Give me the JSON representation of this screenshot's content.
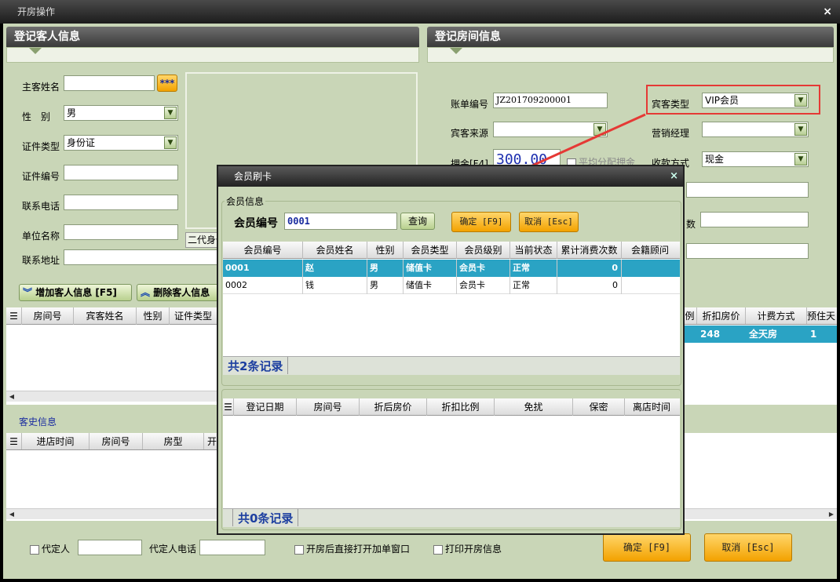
{
  "window": {
    "title": "开房操作",
    "close": "×"
  },
  "guest": {
    "section_title": "登记客人信息",
    "name_label": "主客姓名",
    "name_value": "",
    "name_btn": "***",
    "gender_label": "性　别",
    "gender_value": "男",
    "idtype_label": "证件类型",
    "idtype_value": "身份证",
    "idno_label": "证件编号",
    "idno_value": "",
    "phone_label": "联系电话",
    "phone_value": "",
    "company_label": "单位名称",
    "company_value": "",
    "address_label": "联系地址",
    "address_value": "",
    "idcard_caption": "二代身份证"
  },
  "room": {
    "section_title": "登记房间信息",
    "bill_label": "账单编号",
    "bill_value": "JZ201709200001",
    "guesttype_label": "宾客类型",
    "guesttype_value": "VIP会员",
    "source_label": "宾客来源",
    "source_value": "",
    "manager_label": "营销经理",
    "manager_value": "",
    "deposit_label": "押金[F4]",
    "deposit_value": "300.00",
    "split_label": "平均分配押金",
    "payment_label": "收款方式",
    "payment_value": "现金",
    "hidden_label": "数"
  },
  "actions": {
    "add_guest": "增加客人信息 [F5]",
    "del_guest": "删除客人信息"
  },
  "room_grid": {
    "headers_left": [
      "房间号",
      "宾客姓名",
      "性别",
      "证件类型"
    ],
    "headers_right": [
      "例",
      "折扣房价",
      "计费方式",
      "预住天"
    ],
    "row_right": [
      "",
      "248",
      "全天房",
      "1"
    ]
  },
  "history": {
    "title": "客史信息",
    "headers": [
      "进店时间",
      "房间号",
      "房型",
      "开"
    ]
  },
  "footer": {
    "proxy_label": "代定人",
    "proxy_value": "",
    "proxy_phone_label": "代定人电话",
    "proxy_phone_value": "",
    "open_after_label": "开房后直接打开加单窗口",
    "print_label": "打印开房信息",
    "ok": "确定 [F9]",
    "cancel": "取消 [Esc]"
  },
  "dialog": {
    "title": "会员刷卡",
    "close": "×",
    "group_label": "会员信息",
    "member_no_label": "会员编号",
    "member_no_value": "0001",
    "query": "查询",
    "ok": "确定 [F9]",
    "cancel": "取消 [Esc]",
    "members_headers": [
      "会员编号",
      "会员姓名",
      "性别",
      "会员类型",
      "会员级别",
      "当前状态",
      "累计消费次数",
      "会籍顾问"
    ],
    "members": [
      [
        "0001",
        "赵",
        "男",
        "储值卡",
        "会员卡",
        "正常",
        "0",
        ""
      ],
      [
        "0002",
        "钱",
        "男",
        "储值卡",
        "会员卡",
        "正常",
        "0",
        ""
      ]
    ],
    "members_total": "共2条记录",
    "history_headers": [
      "登记日期",
      "房间号",
      "折后房价",
      "折扣比例",
      "免扰",
      "保密",
      "离店时间"
    ],
    "history_total": "共0条记录"
  },
  "colors": {
    "highlight_row": "#2aa3c4",
    "annotation": "#e53935",
    "orange_btn": "#f3a200"
  }
}
